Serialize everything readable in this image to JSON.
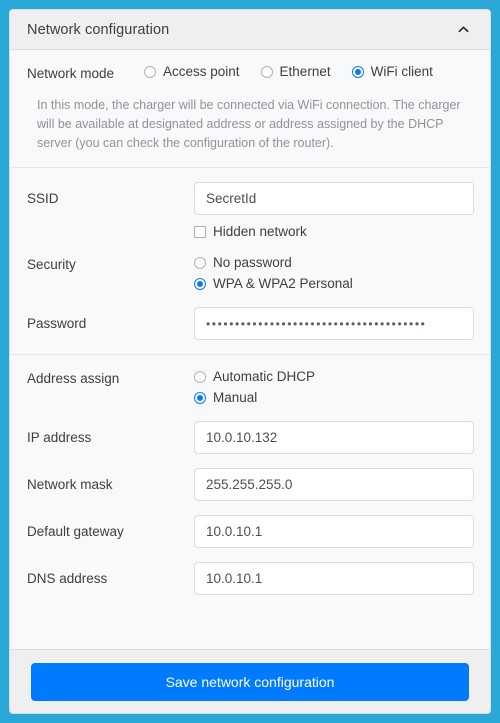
{
  "panel": {
    "title": "Network configuration",
    "collapse_icon": "chevron-up-icon"
  },
  "network_mode": {
    "label": "Network mode",
    "options": [
      {
        "label": "Access point",
        "selected": false
      },
      {
        "label": "Ethernet",
        "selected": false
      },
      {
        "label": "WiFi client",
        "selected": true
      }
    ]
  },
  "description": "In this mode, the charger will be connected via WiFi connection. The charger will be available at designated address or address assigned by the DHCP server (you can check the configuration of the router).",
  "ssid": {
    "label": "SSID",
    "value": "SecretId",
    "hidden_network_label": "Hidden network",
    "hidden_network_checked": false
  },
  "security": {
    "label": "Security",
    "options": [
      {
        "label": "No password",
        "selected": false
      },
      {
        "label": "WPA & WPA2 Personal",
        "selected": true
      }
    ]
  },
  "password": {
    "label": "Password",
    "value": "••••••••••••••••••••••••••••••••••••••"
  },
  "address_assign": {
    "label": "Address assign",
    "options": [
      {
        "label": "Automatic DHCP",
        "selected": false
      },
      {
        "label": "Manual",
        "selected": true
      }
    ]
  },
  "fields": [
    {
      "label": "IP address",
      "value": "10.0.10.132"
    },
    {
      "label": "Network mask",
      "value": "255.255.255.0"
    },
    {
      "label": "Default gateway",
      "value": "10.0.10.1"
    },
    {
      "label": "DNS address",
      "value": "10.0.10.1"
    }
  ],
  "footer": {
    "save_label": "Save network configuration"
  },
  "colors": {
    "page_background": "#29a8d8",
    "panel_background": "#f8f9fa",
    "header_background": "#efefef",
    "accent": "#007bff",
    "radio_selected": "#0a7bf0",
    "text": "#3c4043",
    "muted_text": "#8f9398"
  }
}
